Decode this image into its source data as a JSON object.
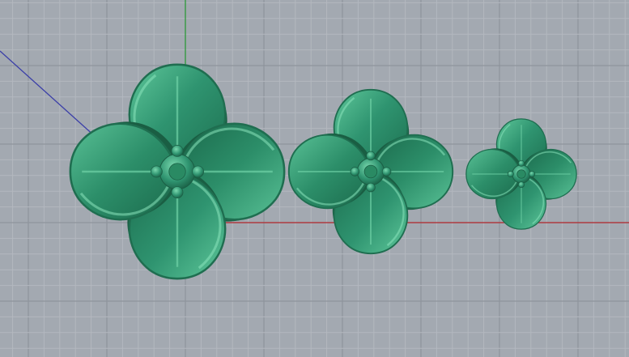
{
  "viewport": {
    "background_color": "#a3a9b1",
    "grid_minor_color": "#b3b8bf",
    "grid_major_color": "#8e949c",
    "axes": {
      "x_color": "#b3282e",
      "y_color": "#2e9a3a",
      "z_color": "#3b3fa8"
    },
    "objects": [
      {
        "name": "flower-large",
        "color": "#2f8f68"
      },
      {
        "name": "flower-medium",
        "color": "#2f8f68"
      },
      {
        "name": "flower-small",
        "color": "#2f8f68"
      }
    ]
  }
}
